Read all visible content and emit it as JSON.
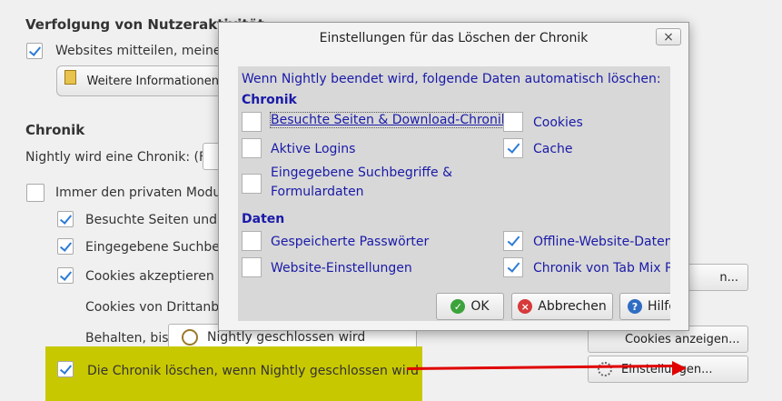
{
  "tracking": {
    "heading": "Verfolgung von Nutzeraktivität",
    "websites_label": "Websites mitteilen, meine A",
    "more_info_button": "Weitere Informationen"
  },
  "history": {
    "heading": "Chronik",
    "nightly_will_label": "Nightly wird eine Chronik: (F)",
    "private_mode_label": "Immer den privaten Modus",
    "visited_label": "Besuchte Seiten und D",
    "search_label": "Eingegebene Suchbeg",
    "cookies_label": "Cookies akzeptieren",
    "third_party_label": "Cookies von Drittanbie",
    "keep_label": "Behalten, bis:",
    "keep_select_value": "Nightly geschlossen wird",
    "clear_on_close_label": "Die Chronik löschen, wenn Nightly geschlossen wird",
    "exceptions_button": "n...",
    "show_cookies_button": "Cookies anzeigen...",
    "settings_button": "Einstellungen..."
  },
  "dialog": {
    "title": "Einstellungen für das Löschen der Chronik",
    "close_symbol": "×",
    "intro": "Wenn Nightly beendet wird, folgende Daten automatisch löschen:",
    "section_history": "Chronik",
    "section_data": "Daten",
    "items": {
      "visited_downloads": "Besuchte Seiten & Download-Chronik",
      "cookies": "Cookies",
      "active_logins": "Aktive Logins",
      "cache": "Cache",
      "search_form_1": "Eingegebene Suchbegriffe &",
      "search_form_2": "Formulardaten",
      "passwords": "Gespeicherte Passwörter",
      "offline_data": "Offline-Website-Daten",
      "site_settings": "Website-Einstellungen",
      "tabmix_history": "Chronik von Tab Mix Plus"
    },
    "ok_button": "OK",
    "cancel_button": "Abbrechen",
    "help_button": "Hilfe"
  },
  "colors": {
    "highlight": "#c8c800",
    "arrow": "#e00000",
    "dialog_text": "#1a1aa8",
    "check": "#2b7bd6"
  }
}
